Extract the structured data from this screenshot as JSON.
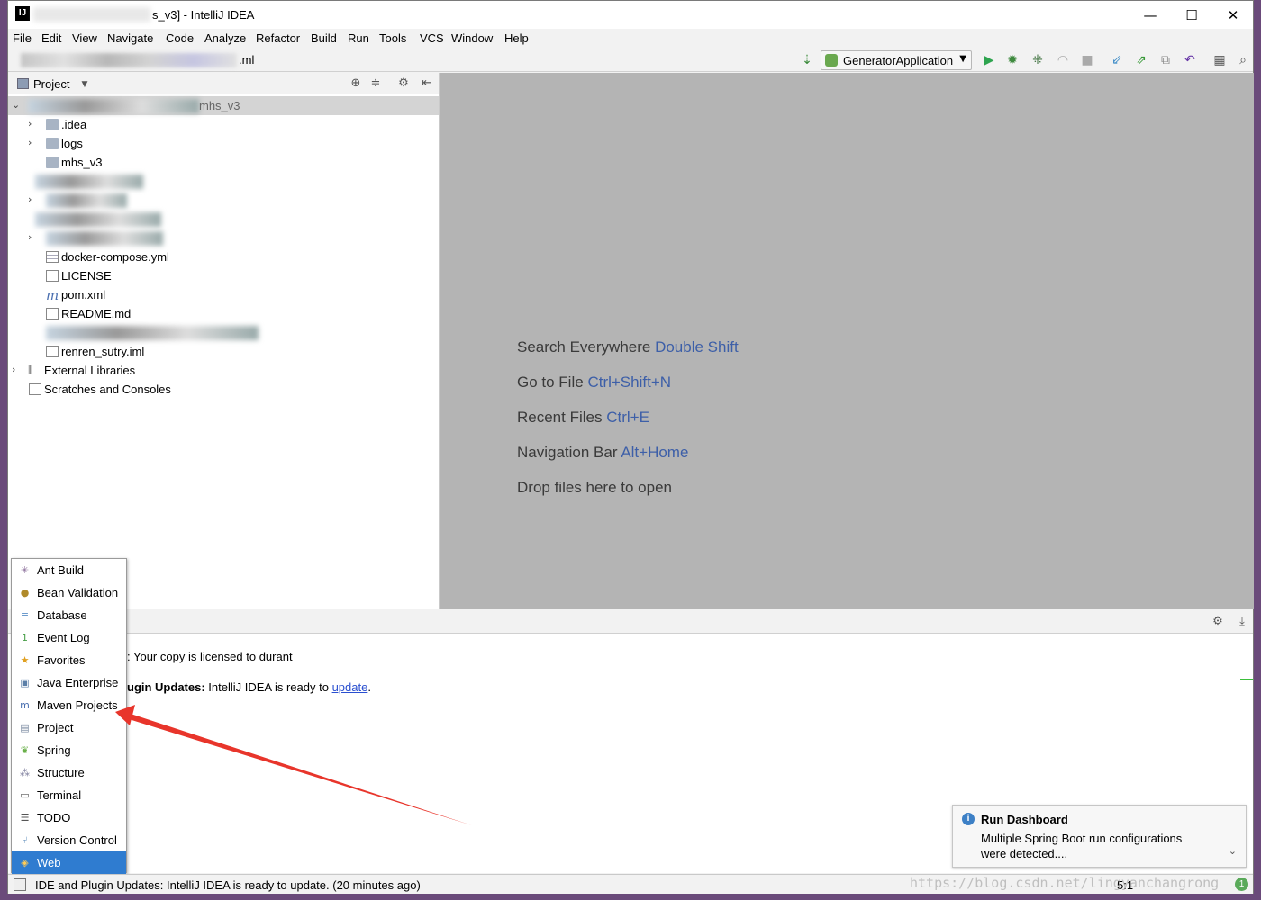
{
  "window": {
    "title": "s_v3] - IntelliJ IDEA",
    "app_icon_label": "IJ",
    "controls": {
      "minimize": "—",
      "maximize": "☐",
      "close": "✕"
    }
  },
  "menu": [
    "File",
    "Edit",
    "View",
    "Navigate",
    "Code",
    "Analyze",
    "Refactor",
    "Build",
    "Run",
    "Tools",
    "VCS",
    "Window",
    "Help"
  ],
  "navbar": {
    "breadcrumb_tail": ".ml",
    "run_config": "GeneratorApplication",
    "icons": [
      "build-icon",
      "run-icon",
      "debug-icon",
      "coverage-icon",
      "profile-icon",
      "stop-icon",
      "vcs-update-icon",
      "vcs-commit-icon",
      "vcs-compare-icon",
      "vcs-revert-icon",
      "project-structure-icon",
      "search-icon"
    ]
  },
  "project_panel": {
    "title": "Project",
    "root_label": "mhs_v3",
    "tree": [
      {
        "label": ".idea",
        "type": "folder",
        "expandable": true
      },
      {
        "label": "logs",
        "type": "folder",
        "expandable": true
      },
      {
        "label": "mhs_v3",
        "type": "folder",
        "expandable": false
      },
      {
        "label": "docker-compose.yml",
        "type": "yml"
      },
      {
        "label": "LICENSE",
        "type": "text"
      },
      {
        "label": "pom.xml",
        "type": "maven"
      },
      {
        "label": "README.md",
        "type": "md"
      },
      {
        "label": "renren_sutry.iml",
        "type": "iml"
      },
      {
        "label": "External Libraries",
        "type": "libs",
        "expandable": true
      },
      {
        "label": "Scratches and Consoles",
        "type": "scratch"
      }
    ]
  },
  "editor_hints": [
    {
      "text": "Search Everywhere",
      "key": "Double Shift"
    },
    {
      "text": "Go to File",
      "key": "Ctrl+Shift+N"
    },
    {
      "text": "Recent Files",
      "key": "Ctrl+E"
    },
    {
      "text": "Navigation Bar",
      "key": "Alt+Home"
    },
    {
      "text": "Drop files here to open",
      "key": ""
    }
  ],
  "event_log": {
    "line1": ": Your copy is licensed to durant",
    "line2_bold": "ugin Updates:",
    "line2_text": " IntelliJ IDEA is ready to ",
    "line2_link": "update",
    "line2_end": "."
  },
  "tool_windows": [
    {
      "label": "Ant Build",
      "icon": "ant-icon",
      "glyph": "✳",
      "color": "#8a6d9a"
    },
    {
      "label": "Bean Validation",
      "icon": "bean-icon",
      "glyph": "●",
      "color": "#b08a2a"
    },
    {
      "label": "Database",
      "icon": "database-icon",
      "glyph": "≡",
      "color": "#5b8fc7"
    },
    {
      "label": "Event Log",
      "icon": "event-log-icon",
      "glyph": "1",
      "color": "#4aa04a"
    },
    {
      "label": "Favorites",
      "icon": "star-icon",
      "glyph": "★",
      "color": "#e0a020"
    },
    {
      "label": "Java Enterprise",
      "icon": "java-enterprise-icon",
      "glyph": "▣",
      "color": "#5b7fa8"
    },
    {
      "label": "Maven Projects",
      "icon": "maven-icon",
      "glyph": "m",
      "color": "#4a6fb0"
    },
    {
      "label": "Project",
      "icon": "project-icon",
      "glyph": "▤",
      "color": "#7a8aa0"
    },
    {
      "label": "Spring",
      "icon": "spring-icon",
      "glyph": "❦",
      "color": "#6ab04a"
    },
    {
      "label": "Structure",
      "icon": "structure-icon",
      "glyph": "⁂",
      "color": "#7a7a9a"
    },
    {
      "label": "Terminal",
      "icon": "terminal-icon",
      "glyph": "▭",
      "color": "#555555"
    },
    {
      "label": "TODO",
      "icon": "todo-icon",
      "glyph": "☰",
      "color": "#555555"
    },
    {
      "label": "Version Control",
      "icon": "version-control-icon",
      "glyph": "⑂",
      "color": "#5a8aba"
    },
    {
      "label": "Web",
      "icon": "web-icon",
      "glyph": "◈",
      "color": "#ffcc55"
    }
  ],
  "notification": {
    "title": "Run Dashboard",
    "body": "Multiple Spring Boot run configurations were detected....",
    "info_glyph": "i"
  },
  "status": {
    "message": "IDE and Plugin Updates: IntelliJ IDEA is ready to update. (20 minutes ago)",
    "position": "5:1",
    "badge": "1"
  },
  "watermark": "https://blog.csdn.net/lingyanchangrong",
  "colors": {
    "accent_blue": "#2f7cd0",
    "hint_key": "#3d5fa8",
    "arrow_red": "#e8352b"
  }
}
